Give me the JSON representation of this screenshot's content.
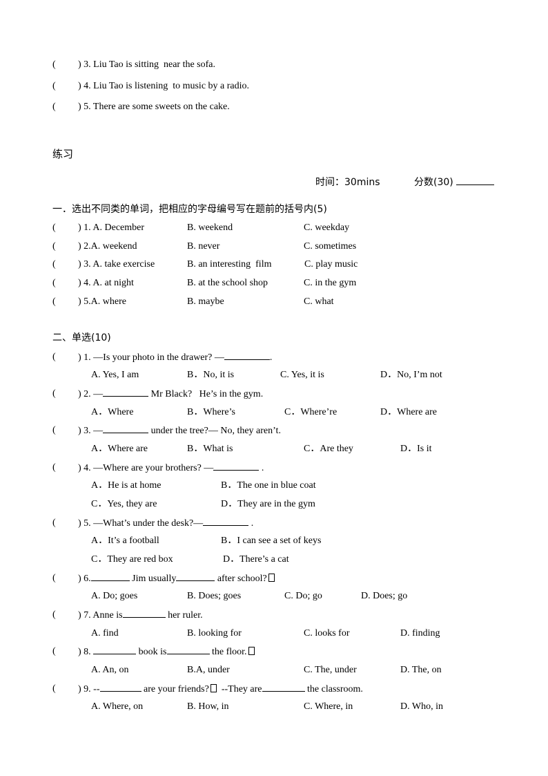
{
  "top_items": [
    {
      "num": ") 3.",
      "text": " Liu Tao is sitting  near the sofa."
    },
    {
      "num": ") 4.",
      "text": " Liu Tao is listening  to music by a radio."
    },
    {
      "num": ") 5.",
      "text": " There are some sweets on the cake."
    }
  ],
  "paren_open": "(",
  "practice_title": "练习",
  "meta": {
    "time_label": "时间：30mins",
    "score_label": "分数(30)"
  },
  "section1": {
    "title": "一．选出不同类的单词，把相应的字母编号写在题前的括号内(5)",
    "items": [
      {
        "num": ") 1. A. December",
        "b": "B. weekend",
        "c": "C. weekday"
      },
      {
        "num": ") 2.A. weekend",
        "b": "B. never",
        "c": "C. sometimes"
      },
      {
        "num": ") 3. A. take exercise",
        "b": "B. an interesting  film",
        "c": "C. play music"
      },
      {
        "num": ") 4. A. at night",
        "b": "B. at the school shop",
        "c": "C. in the gym"
      },
      {
        "num": ") 5.A. where",
        "b": "B. maybe",
        "c": "C. what"
      }
    ]
  },
  "section2": {
    "title": "二、单选(10)",
    "q1": {
      "pre": ") 1. —Is your photo in the drawer? —",
      "post": ".",
      "a": "A. Yes, I am",
      "b": "B．No, it is",
      "c": "C. Yes, it is",
      "d": "D．No, I’m not"
    },
    "q2": {
      "pre": ") 2. —",
      "post": " Mr Black?   He’s in the gym.",
      "a": "A．Where",
      "b": "B．Where’s",
      "c": "C．Where’re",
      "d": "D．Where are"
    },
    "q3": {
      "pre": ") 3. —",
      "post": " under the tree?— No, they aren’t.",
      "a": "A．Where are",
      "b": "B．What is",
      "c": "C．Are they",
      "d": "D．Is it"
    },
    "q4": {
      "pre": ") 4. —Where are your brothers? —",
      "post": " .",
      "a": "A．He is at home",
      "b": "B．The one in blue coat",
      "c": "C．Yes, they are",
      "d": "D．They are in the gym"
    },
    "q5": {
      "pre": ") 5. —What’s under the desk?—",
      "post": " .",
      "a": "A．It’s a football",
      "b": "B．I can see a set of keys",
      "c": "C．They are red box",
      "d": "D．There’s a cat"
    },
    "q6": {
      "pre": ") 6.",
      "mid": " Jim usually",
      "post": " after school?",
      "a": "A. Do; goes",
      "b": "B. Does; goes",
      "c": "C. Do; go",
      "d": "D. Does; go"
    },
    "q7": {
      "pre": ") 7. Anne is",
      "post": " her ruler.",
      "a": "A. find",
      "b": "B. looking for",
      "c": "C. looks for",
      "d": "D. finding"
    },
    "q8": {
      "pre": ") 8. ",
      "mid": " book is",
      "post": " the floor.",
      "a": "A. An, on",
      "b": "B.A, under",
      "c": "C. The, under",
      "d": "D. The, on"
    },
    "q9": {
      "pre": ") 9. --",
      "mid": " are your friends?",
      "mid2": "  --They are",
      "post": " the classroom.",
      "a": "A. Where, on",
      "b": "B. How, in",
      "c": "C. Where, in",
      "d": "D. Who, in"
    }
  }
}
